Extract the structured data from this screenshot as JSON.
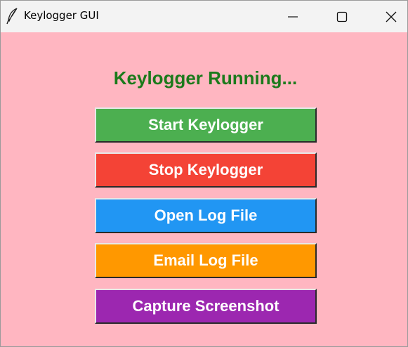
{
  "window": {
    "title": "Keylogger GUI",
    "app_icon": "feather-icon",
    "controls": {
      "minimize": "minimize-icon",
      "maximize": "maximize-icon",
      "close": "close-icon"
    },
    "background_color": "#ffb6c1"
  },
  "status": {
    "text": "Keylogger Running...",
    "color": "#1b7a1b"
  },
  "buttons": [
    {
      "label": "Start Keylogger",
      "color": "#4caf50"
    },
    {
      "label": "Stop Keylogger",
      "color": "#f44336"
    },
    {
      "label": "Open Log File",
      "color": "#2196f3"
    },
    {
      "label": "Email Log File",
      "color": "#ff9800"
    },
    {
      "label": "Capture Screenshot",
      "color": "#9c27b0"
    }
  ]
}
